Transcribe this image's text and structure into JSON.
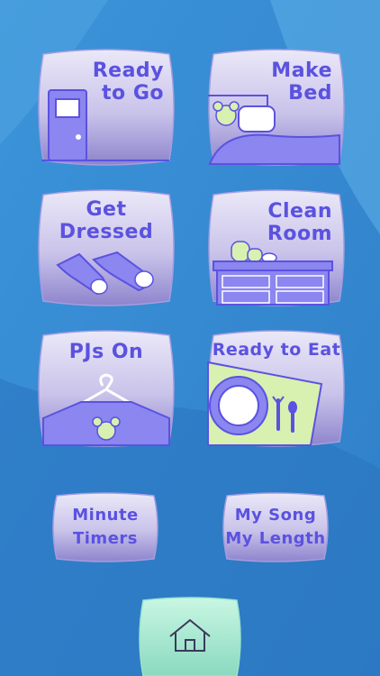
{
  "tiles": {
    "ready_to_go": {
      "line1": "Ready",
      "line2": "to Go"
    },
    "make_bed": {
      "line1": "Make",
      "line2": "Bed"
    },
    "get_dressed": {
      "line1": "Get",
      "line2": "Dressed"
    },
    "clean_room": {
      "line1": "Clean",
      "line2": "Room"
    },
    "pjs_on": {
      "label": "PJs On"
    },
    "ready_to_eat": {
      "label": "Ready to Eat"
    }
  },
  "small_buttons": {
    "minute_timers": {
      "line1": "Minute",
      "line2": "Timers"
    },
    "my_song": {
      "line1": "My Song",
      "line2": "My Length"
    }
  },
  "colors": {
    "background": "#3a8fd4",
    "tile_top": "#e8e4f7",
    "tile_bottom": "#8f86cf",
    "text": "#5b52e0",
    "illustration": "#8b86f0",
    "accent_green": "#d8f0b0",
    "home_button": "#b6f0d6"
  },
  "icons": {
    "home": "home-icon"
  }
}
